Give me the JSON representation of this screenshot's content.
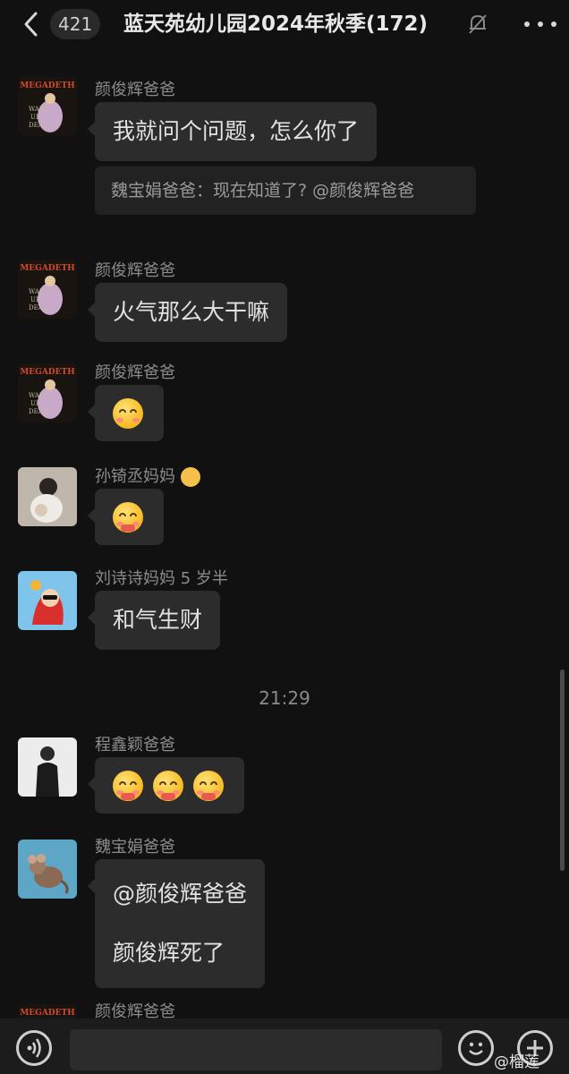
{
  "header": {
    "unread_count": "421",
    "title": "蓝天苑幼儿园2024年秋季(172)"
  },
  "messages": [
    {
      "sender": "颜俊辉爸爸",
      "text": "我就问个问题，怎么你了",
      "quote": "魏宝娟爸爸：现在知道了? @颜俊辉爸爸"
    },
    {
      "sender": "颜俊辉爸爸",
      "text": "火气那么大干嘛"
    },
    {
      "sender": "颜俊辉爸爸",
      "sticker": "thinking-emoji"
    },
    {
      "sender": "孙锜丞妈妈",
      "sticker": "shy-emoji"
    },
    {
      "sender": "刘诗诗妈妈 5 岁半",
      "text": "和气生财"
    },
    {
      "sender": "程鑫颖爸爸",
      "sticker": "shy-emoji x3"
    },
    {
      "sender": "魏宝娟爸爸",
      "lines": [
        "@颜俊辉爸爸",
        "颜俊辉死了"
      ]
    },
    {
      "sender": "颜俊辉爸爸"
    }
  ],
  "timestamp": "21:29",
  "avatar_logo_text": "MEGADETH",
  "watermark": "@榴莲"
}
